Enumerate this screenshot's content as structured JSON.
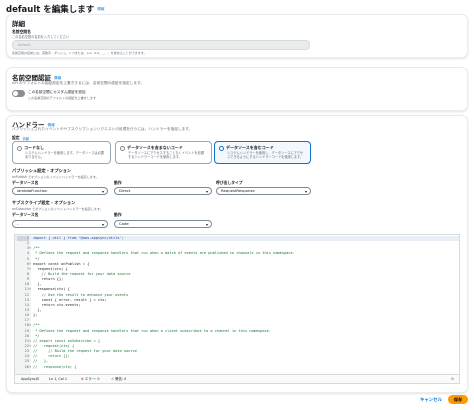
{
  "page": {
    "title": "default を編集します",
    "info": "情報"
  },
  "details": {
    "heading": "詳細",
    "name_label": "名前空間名",
    "name_desc": "この名前空間の名前を入力してください",
    "name_placeholder": "default",
    "name_hint": "名前空間の名前には、英数字、ダッシュ、1 つまたは、a-z、0-9、_、-、を含めることができます。"
  },
  "auth": {
    "heading": "名前空間認証",
    "info": "情報",
    "desc": "API のデフォルトの認証設定を上書きするには、名前空間の認証を指定します。",
    "toggle_label": "この名前空間にカスタム認証を追加",
    "toggle_desc": "この名前空間のデフォルトの認証を上書きします"
  },
  "handler": {
    "heading": "ハンドラー",
    "info": "情報",
    "desc": "パブリッシュされたイベントやサブスクリプションリクエストの処理を行うには、ハンドラーを指定します。",
    "settings_label": "設定",
    "settings_info": "情報",
    "options": [
      {
        "title": "コードなし",
        "desc": "システムハンドラーを使用します。データソースは必要ありません。"
      },
      {
        "title": "データソースを含まないコード",
        "desc": "データソースにアクセスすることなくイベントを処理するハンドラーコードを使用します。"
      },
      {
        "title": "データソースを含むコード",
        "desc": "システムハンドラーを使用し、データソースにアクセスできるようにするハンドラーコードを使用します。"
      }
    ],
    "publish": {
      "label": "パブリッシュ設定 - オプション",
      "desc": "onPublish でオプションのイベントハンドラーを設定します。",
      "ds_label": "データソース名",
      "ds_value": "lambdaFunction",
      "action_label": "動作",
      "action_value": "Direct",
      "invoke_label": "呼び出しタイプ",
      "invoke_value": "RequestResponse"
    },
    "subscribe": {
      "label": "サブスクライブ設定 - オプション",
      "desc": "onSubscribe でオプションのイベントハンドラーを設定します。",
      "ds_label": "データソース名",
      "ds_value": "-",
      "action_label": "動作",
      "action_value": "Code"
    }
  },
  "editor": {
    "lines": [
      {
        "n": "1",
        "fold": "",
        "code": "import { util } from '@aws-appsync/utils';"
      },
      {
        "n": "2",
        "fold": "",
        "code": ""
      },
      {
        "n": "3",
        "fold": "▾",
        "code": "/**"
      },
      {
        "n": "4",
        "fold": "",
        "code": " * Defines the request and response handlers that run when a batch of events are published to channels in this namespace."
      },
      {
        "n": "5",
        "fold": "",
        "code": " */"
      },
      {
        "n": "6",
        "fold": "▾",
        "code": "export const onPublish = {"
      },
      {
        "n": "7",
        "fold": "▾",
        "code": "  request(ctx) {"
      },
      {
        "n": "8",
        "fold": "",
        "code": "    // Build the request for your data source"
      },
      {
        "n": "9",
        "fold": "",
        "code": "    return {};"
      },
      {
        "n": "10",
        "fold": "",
        "code": "  },"
      },
      {
        "n": "11",
        "fold": "▾",
        "code": "  response(ctx) {"
      },
      {
        "n": "12",
        "fold": "",
        "code": "    // Use the result to enhance your events"
      },
      {
        "n": "13",
        "fold": "",
        "code": "    const { error, result } = ctx;"
      },
      {
        "n": "14",
        "fold": "",
        "code": "    return ctx.events;"
      },
      {
        "n": "15",
        "fold": "",
        "code": "  },"
      },
      {
        "n": "16",
        "fold": "",
        "code": "};"
      },
      {
        "n": "17",
        "fold": "",
        "code": ""
      },
      {
        "n": "18",
        "fold": "▾",
        "code": "/**"
      },
      {
        "n": "19",
        "fold": "",
        "code": " * Defines the request and response handlers that run when a client subscribes to a channel in this namespace."
      },
      {
        "n": "20",
        "fold": "",
        "code": " */"
      },
      {
        "n": "21",
        "fold": "▾",
        "code": "// export const onSubscribe = {"
      },
      {
        "n": "22",
        "fold": "▾",
        "code": "//   request(ctx) {"
      },
      {
        "n": "23",
        "fold": "",
        "code": "//     // Build the request for your data source"
      },
      {
        "n": "24",
        "fold": "",
        "code": "//     return {};"
      },
      {
        "n": "25",
        "fold": "",
        "code": "//   },"
      },
      {
        "n": "26",
        "fold": "▾",
        "code": "//   response(ctx) {"
      }
    ],
    "status": {
      "lang": "AppSyncJS",
      "position": "Ln 1, Col 1",
      "errors": "エラー: 0",
      "warnings": "警告: 0"
    }
  },
  "footer": {
    "cancel": "キャンセル",
    "save": "保存"
  },
  "colors": {
    "accent": "#0972d3",
    "primary_button": "#ff9900",
    "error": "#d91515",
    "warning": "#8d6605"
  }
}
